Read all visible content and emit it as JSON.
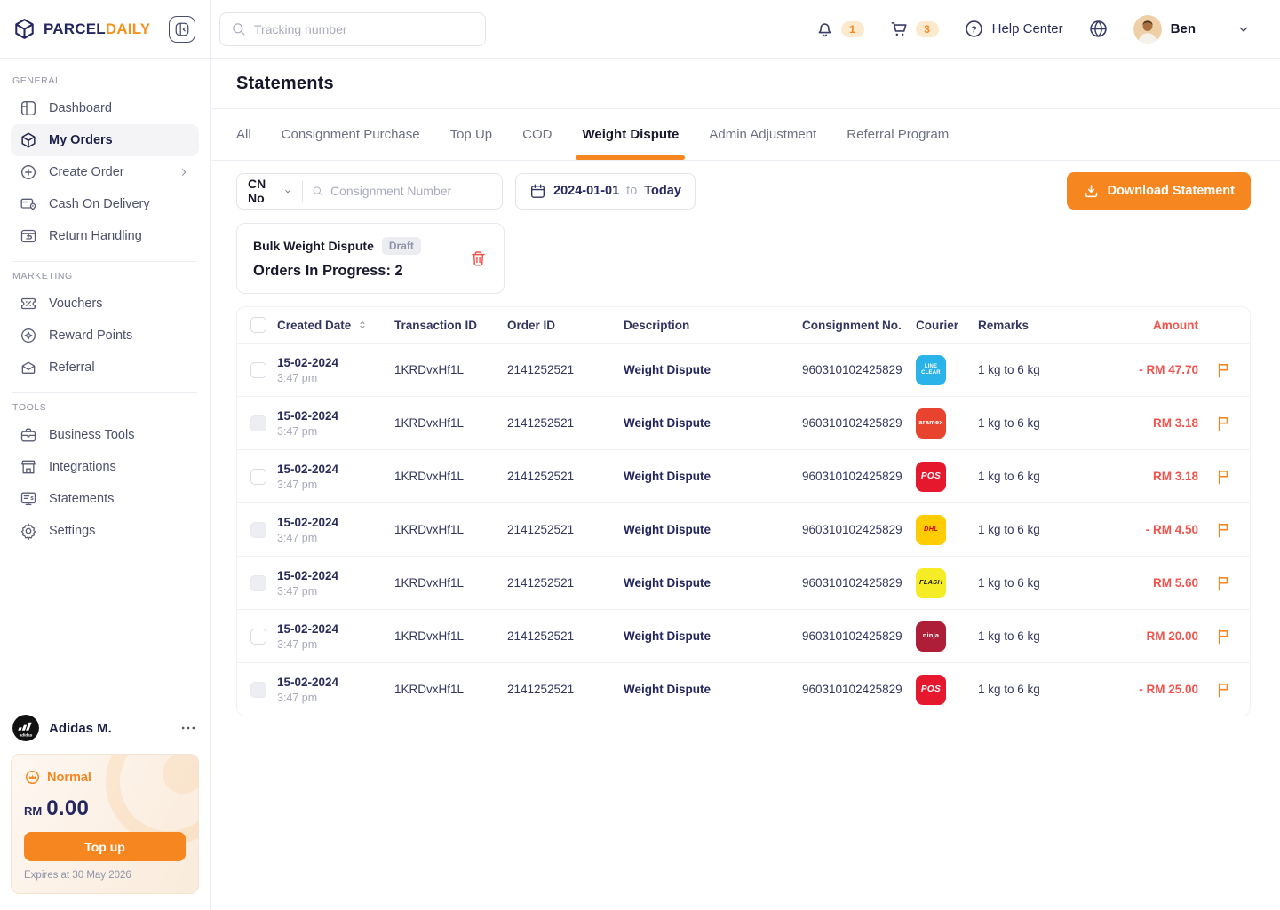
{
  "brand": {
    "name_primary": "PARCEL",
    "name_secondary": "DAILY"
  },
  "topbar": {
    "search_placeholder": "Tracking number",
    "notification_count": "1",
    "cart_count": "3",
    "help_label": "Help Center",
    "user_name": "Ben"
  },
  "sidebar": {
    "sections": [
      {
        "label": "GENERAL",
        "items": [
          {
            "label": "Dashboard"
          },
          {
            "label": "My Orders"
          },
          {
            "label": "Create Order"
          },
          {
            "label": "Cash On Delivery"
          },
          {
            "label": "Return Handling"
          }
        ]
      },
      {
        "label": "MARKETING",
        "items": [
          {
            "label": "Vouchers"
          },
          {
            "label": "Reward Points"
          },
          {
            "label": "Referral"
          }
        ]
      },
      {
        "label": "TOOLS",
        "items": [
          {
            "label": "Business Tools"
          },
          {
            "label": "Integrations"
          },
          {
            "label": "Statements"
          },
          {
            "label": "Settings"
          }
        ]
      }
    ],
    "profile": {
      "name": "Adidas M."
    },
    "wallet": {
      "tier": "Normal",
      "currency": "RM",
      "balance": "0.00",
      "topup_label": "Top up",
      "expiry": "Expires at 30 May 2026"
    }
  },
  "page": {
    "title": "Statements"
  },
  "tabs": [
    {
      "label": "All"
    },
    {
      "label": "Consignment Purchase"
    },
    {
      "label": "Top Up"
    },
    {
      "label": "COD"
    },
    {
      "label": "Weight Dispute"
    },
    {
      "label": "Admin Adjustment"
    },
    {
      "label": "Referral Program"
    }
  ],
  "filters": {
    "cn_dropdown": "CN No",
    "search_placeholder": "Consignment Number",
    "date_from": "2024-01-01",
    "date_to_word": "to",
    "date_to": "Today",
    "download_label": "Download Statement"
  },
  "bulk_card": {
    "title": "Bulk Weight Dispute",
    "badge": "Draft",
    "subtitle": "Orders In Progress: 2"
  },
  "table": {
    "headers": {
      "created_date": "Created Date",
      "transaction_id": "Transaction ID",
      "order_id": "Order ID",
      "description": "Description",
      "consignment_no": "Consignment No.",
      "courier": "Courier",
      "remarks": "Remarks",
      "amount": "Amount"
    },
    "rows": [
      {
        "date": "15-02-2024",
        "time": "3:47 pm",
        "transaction_id": "1KRDvxHf1L",
        "order_id": "2141252521",
        "description": "Weight Dispute",
        "consignment_no": "960310102425829",
        "courier": "lineclear",
        "remarks": "1 kg to 6 kg",
        "amount": "- RM 47.70",
        "checkbox_enabled": true
      },
      {
        "date": "15-02-2024",
        "time": "3:47 pm",
        "transaction_id": "1KRDvxHf1L",
        "order_id": "2141252521",
        "description": "Weight Dispute",
        "consignment_no": "960310102425829",
        "courier": "aramex",
        "remarks": "1 kg to 6 kg",
        "amount": "RM 3.18",
        "checkbox_enabled": false
      },
      {
        "date": "15-02-2024",
        "time": "3:47 pm",
        "transaction_id": "1KRDvxHf1L",
        "order_id": "2141252521",
        "description": "Weight Dispute",
        "consignment_no": "960310102425829",
        "courier": "pos",
        "remarks": "1 kg to 6 kg",
        "amount": "RM 3.18",
        "checkbox_enabled": true
      },
      {
        "date": "15-02-2024",
        "time": "3:47 pm",
        "transaction_id": "1KRDvxHf1L",
        "order_id": "2141252521",
        "description": "Weight Dispute",
        "consignment_no": "960310102425829",
        "courier": "dhl",
        "remarks": "1 kg to 6 kg",
        "amount": "- RM 4.50",
        "checkbox_enabled": false
      },
      {
        "date": "15-02-2024",
        "time": "3:47 pm",
        "transaction_id": "1KRDvxHf1L",
        "order_id": "2141252521",
        "description": "Weight Dispute",
        "consignment_no": "960310102425829",
        "courier": "flash",
        "remarks": "1 kg to 6 kg",
        "amount": "RM 5.60",
        "checkbox_enabled": false
      },
      {
        "date": "15-02-2024",
        "time": "3:47 pm",
        "transaction_id": "1KRDvxHf1L",
        "order_id": "2141252521",
        "description": "Weight Dispute",
        "consignment_no": "960310102425829",
        "courier": "ninja",
        "remarks": "1 kg to 6 kg",
        "amount": "RM 20.00",
        "checkbox_enabled": true
      },
      {
        "date": "15-02-2024",
        "time": "3:47 pm",
        "transaction_id": "1KRDvxHf1L",
        "order_id": "2141252521",
        "description": "Weight Dispute",
        "consignment_no": "960310102425829",
        "courier": "pos",
        "remarks": "1 kg to 6 kg",
        "amount": "- RM 25.00",
        "checkbox_enabled": false
      }
    ]
  },
  "couriers": {
    "lineclear": {
      "name": "Line Clear Express",
      "bg": "#2AB3E8",
      "fg": "#FFFFFF",
      "text": "LINE\nCLEAR",
      "size": "f-sm"
    },
    "aramex": {
      "name": "Aramex",
      "bg": "#E8432F",
      "fg": "#FFFFFF",
      "text": "aramex",
      "size": "f-med"
    },
    "pos": {
      "name": "Pos Malaysia",
      "bg": "#E6182E",
      "fg": "#FFFFFF",
      "text": "POS",
      "size": "f-big",
      "italic": true
    },
    "dhl": {
      "name": "DHL",
      "bg": "#FFCC00",
      "fg": "#D40511",
      "text": "DHL",
      "size": "f-med",
      "italic": true
    },
    "flash": {
      "name": "Flash Express",
      "bg": "#F6EC25",
      "fg": "#1A1A1A",
      "text": "FLASH",
      "size": "f-med",
      "italic": true
    },
    "ninja": {
      "name": "Ninja Van",
      "bg": "#AF1E38",
      "fg": "#FFFFFF",
      "text": "ninja",
      "size": "f-med"
    }
  },
  "colors": {
    "accent_orange": "#F6861F",
    "amount_red": "#F2544D",
    "navy_text": "#23265F",
    "badge_bg": "#FCE9CE"
  }
}
